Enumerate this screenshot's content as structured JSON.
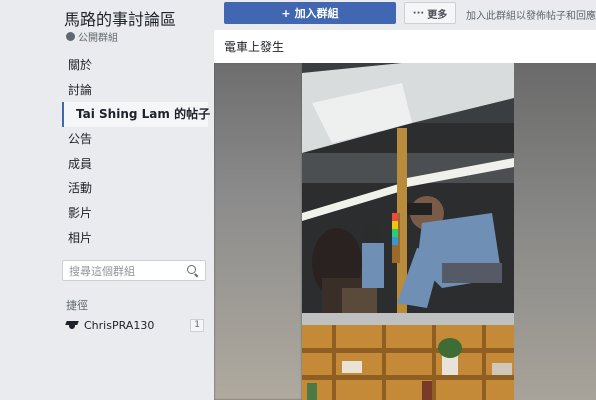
{
  "group": {
    "title": "馬路的事討論區",
    "privacy": "公開群組"
  },
  "nav": {
    "items": [
      {
        "label": "關於"
      },
      {
        "label": "討論"
      },
      {
        "label": "Tai Shing Lam 的帖子",
        "active": true
      },
      {
        "label": "公告"
      },
      {
        "label": "成員"
      },
      {
        "label": "活動"
      },
      {
        "label": "影片"
      },
      {
        "label": "相片"
      }
    ]
  },
  "search": {
    "placeholder": "搜尋這個群組"
  },
  "shortcuts": {
    "label": "捷徑",
    "items": [
      {
        "label": "ChrisPRA130",
        "count": "1"
      }
    ]
  },
  "topbar": {
    "join_label": "加入群組",
    "more_label": "更多",
    "join_hint": "加入此群組以發佈帖子和回應"
  },
  "post": {
    "text": "電車上發生"
  },
  "colors": {
    "primary": "#4267b2",
    "background": "#e9ebee"
  }
}
